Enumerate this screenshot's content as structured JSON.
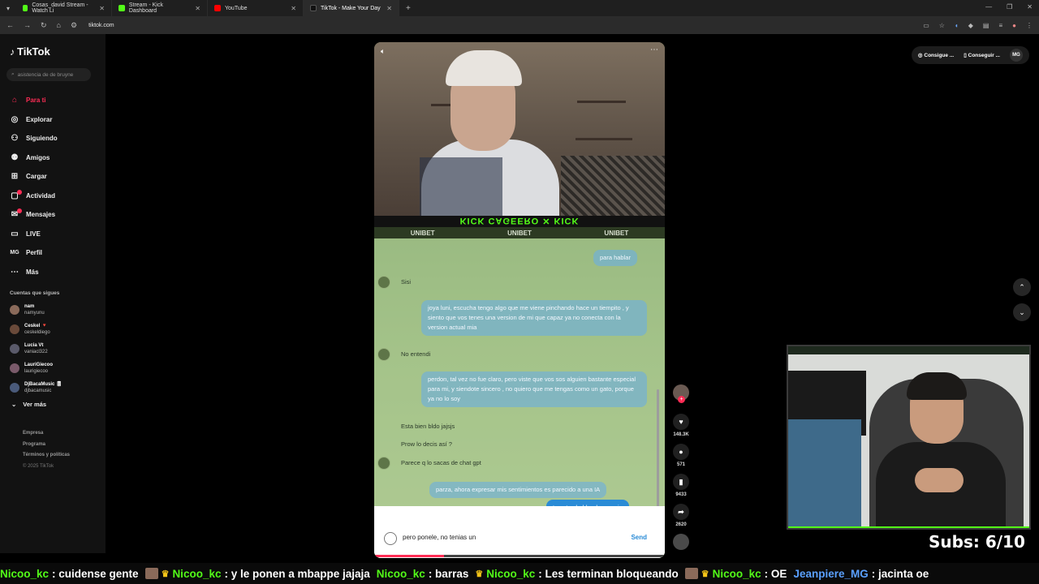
{
  "browser": {
    "tabs": [
      {
        "title": "Cosas_david Stream - Watch Li",
        "color": "#53fc18"
      },
      {
        "title": "Stream - Kick Dashboard",
        "color": "#53fc18"
      },
      {
        "title": "YouTube",
        "color": "#ff0000"
      },
      {
        "title": "TikTok - Make Your Day",
        "color": "#111111"
      }
    ],
    "url": "tiktok.com"
  },
  "sidebar": {
    "logo": "TikTok",
    "search_placeholder": "asistencia de de bruyne",
    "nav": [
      {
        "label": "Para ti",
        "icon": "home-icon"
      },
      {
        "label": "Explorar",
        "icon": "compass-icon"
      },
      {
        "label": "Siguiendo",
        "icon": "following-icon"
      },
      {
        "label": "Amigos",
        "icon": "friends-icon"
      },
      {
        "label": "Cargar",
        "icon": "upload-icon"
      },
      {
        "label": "Actividad",
        "icon": "activity-icon"
      },
      {
        "label": "Mensajes",
        "icon": "messages-icon"
      },
      {
        "label": "LIVE",
        "icon": "live-icon"
      },
      {
        "label": "Perfil",
        "icon": "profile-icon"
      },
      {
        "label": "Más",
        "icon": "more-icon"
      }
    ],
    "following_title": "Cuentas que sigues",
    "accounts": [
      {
        "name": "nam",
        "handle": "namyunu"
      },
      {
        "name": "Ceskel 🔻",
        "handle": "ceskeldiego"
      },
      {
        "name": "Lucia Vt",
        "handle": "vaniacl322"
      },
      {
        "name": "LauriGiecoo",
        "handle": "laurigiecoo"
      },
      {
        "name": "DjBacaMusic 🎚",
        "handle": "djbacamusic"
      }
    ],
    "ver_mas": "Ver más",
    "footer": [
      "Empresa",
      "Programa",
      "Términos y políticas"
    ],
    "copyright": "© 2025 TikTok"
  },
  "header": {
    "btn1": "Consigue ...",
    "btn2": "Conseguir ...",
    "avatar": "MG"
  },
  "video": {
    "top_banner": "UNIBET",
    "messages": [
      {
        "type": "sent",
        "text": "para hablar"
      },
      {
        "type": "recv",
        "text": "Sisi"
      },
      {
        "type": "sent",
        "text": "joya luni, escucha tengo algo que me viene pinchando hace un tiempito , y siento que vos tenes una version de mi que capaz ya no conecta con la version actual mia"
      },
      {
        "type": "recv",
        "text": "No entendi"
      },
      {
        "type": "sent",
        "text": "perdon, tal vez no fue claro, pero viste que vos sos alguien bastante especial para mi, y siendote sincero , no quiero que me tengas como un gato, porque ya no lo soy"
      },
      {
        "type": "recv",
        "text": "Esta bien bldo jajsjs"
      },
      {
        "type": "recv",
        "text": "Prow lo decis así ?"
      },
      {
        "type": "recv",
        "text": "Parece q lo sacas de chat gpt"
      },
      {
        "type": "sent",
        "text": "parza, ahora expresar mis sentimientos es parecido a una IA"
      },
      {
        "type": "sent_solid",
        "text": "te estoy hablando enserio"
      }
    ],
    "compose_text": "pero ponele, no tenias un",
    "send_label": "Send",
    "progress": 0.24
  },
  "actions": {
    "likes": "148.3K",
    "comments": "571",
    "saves": "9433",
    "shares": "2620"
  },
  "overlay": {
    "subs": "Subs: 6/10"
  },
  "ticker": [
    {
      "user": "Nicoo_kc",
      "msg": ": cuidense gente",
      "crown": false
    },
    {
      "user": "Nicoo_kc",
      "msg": ": y le ponen a mbappe jajaja",
      "crown": true
    },
    {
      "user": "Nicoo_kc",
      "msg": ": barras",
      "crown": false
    },
    {
      "user": "Nicoo_kc",
      "msg": ": Les terminan bloqueando",
      "crown": true
    },
    {
      "user": "Nicoo_kc",
      "msg": ": OE",
      "crown": true
    },
    {
      "user": "Jeanpiere_MG",
      "msg": ": jacinta oe",
      "crown": false
    }
  ]
}
